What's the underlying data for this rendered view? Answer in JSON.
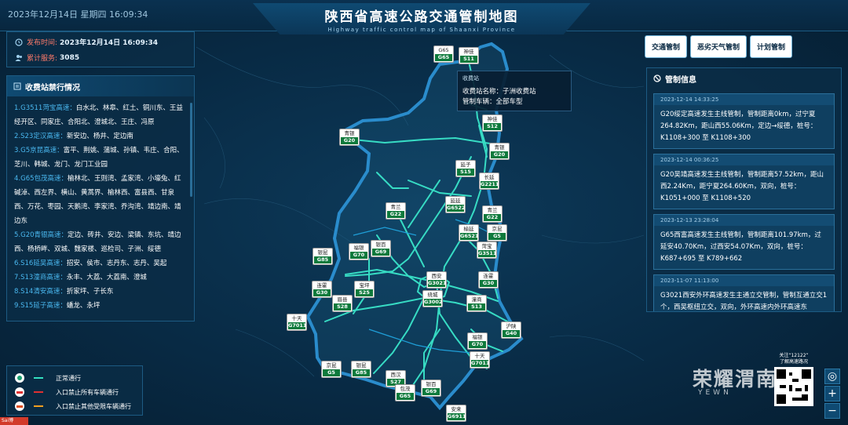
{
  "header": {
    "datetime": "2023年12月14日 星期四  16:09:34",
    "title": "陕西省高速公路交通管制地图",
    "subtitle": "Highway traffic control map of Shaanxi Province"
  },
  "publish": {
    "time_label": "发布时间:",
    "time_value": "2023年12月14日 16:09:34",
    "service_label": "累计服务:",
    "service_value": "3085"
  },
  "toll": {
    "title": "收费站禁行情况",
    "items": [
      {
        "road": "1.G3511菏宝高速：",
        "stations": "白水北、林皋、红土、铜川东、王益经开区、同家庄、合阳北、澄城北、王庄、冯原"
      },
      {
        "road": "2.S23定汉高速：",
        "stations": "新安边、杨井、定边南"
      },
      {
        "road": "3.G5京昆高速：",
        "stations": "富平、荆姚、蒲城、孙镇、韦庄、合阳、芝川、韩城、龙门、龙门工业园"
      },
      {
        "road": "4.G65包茂高速：",
        "stations": "榆林北、王则湾、孟家湾、小壕兔、红碱淖、西左界、横山、黄蒿界、榆林西、富县西、甘泉西、万花、枣园、天鹅湾、李家湾、乔沟湾、靖边南、靖边东"
      },
      {
        "road": "5.G20青银高速：",
        "stations": "定边、砖井、安边、梁镇、东坑、靖边西、杨桥畔、双城、魏家楼、巡检司、子洲、绥德"
      },
      {
        "road": "6.S16延吴高速：",
        "stations": "招安、侯市、志丹东、志丹、吴起"
      },
      {
        "road": "7.S13潼商高速：",
        "stations": "永丰、大荔、大荔南、澄城"
      },
      {
        "road": "8.S14清安高速：",
        "stations": "折家坪、子长东"
      },
      {
        "road": "9.S15延子高速：",
        "stations": "蟠龙、永坪"
      }
    ]
  },
  "legend": {
    "items": [
      {
        "label": "正常通行",
        "color": "#33e0c0"
      },
      {
        "label": "入口禁止所有车辆通行",
        "color": "#e03030"
      },
      {
        "label": "入口禁止其他受限车辆通行",
        "color": "#f0a020"
      }
    ]
  },
  "tabs": [
    "交通管制",
    "恶劣天气管制",
    "计划管制"
  ],
  "info": {
    "title": "管制信息",
    "cards": [
      {
        "time": "2023-12-14 14:33:25",
        "text": "G20绥定高速发生主线管制，管制距离0km，过宁夏264.82Km，距山西55.06Km，定边→绥德，桩号：K1108+300 至 K1108+300"
      },
      {
        "time": "2023-12-14 00:36:25",
        "text": "G20吴靖高速发生主线管制，管制距离57.52km，距山西2.24Km，距宁夏264.60Km，双向，桩号：K1051+000 至 K1108+520"
      },
      {
        "time": "2023-12-13 23:28:04",
        "text": "G65西富高速发生主线管制，管制距离101.97km，过延安40.70Km，过西安54.07Km，双向，桩号：K687+695 至 K789+662"
      },
      {
        "time": "2023-11-07 11:13:00",
        "text": "G3021西安外环高速发生主通立交管制，管制互通立交1个，西吴枢纽立交，双向，外环高速内外环高速东"
      }
    ]
  },
  "tooltip": {
    "title": "收费站",
    "name_row": "收费站名称：子洲收费站",
    "type_row": "管制车辆：全部车型"
  },
  "badges": [
    {
      "name": "G65",
      "code": "G65",
      "top": true
    },
    {
      "name": "神佳",
      "code": "S11"
    },
    {
      "name": "青银",
      "code": "G20"
    },
    {
      "name": "神佳",
      "code": "S12"
    },
    {
      "name": "青银",
      "code": "G20"
    },
    {
      "name": "延子",
      "code": "S15"
    },
    {
      "name": "长延",
      "code": "G2211"
    },
    {
      "name": "青兰",
      "code": "G22"
    },
    {
      "name": "延延",
      "code": "G6522"
    },
    {
      "name": "青兰",
      "code": "G22"
    },
    {
      "name": "榆延",
      "code": "G6521"
    },
    {
      "name": "京昆",
      "code": "G5"
    },
    {
      "name": "菏宝",
      "code": "G3511"
    },
    {
      "name": "福银",
      "code": "G70"
    },
    {
      "name": "银百",
      "code": "G69"
    },
    {
      "name": "银昆",
      "code": "G85"
    },
    {
      "name": "西安",
      "code": "G3021"
    },
    {
      "name": "连霍",
      "code": "G30"
    },
    {
      "name": "宝坪",
      "code": "S25"
    },
    {
      "name": "绕城",
      "code": "G3002"
    },
    {
      "name": "连霍",
      "code": "G30"
    },
    {
      "name": "眉县",
      "code": "S28"
    },
    {
      "name": "潼商",
      "code": "S13"
    },
    {
      "name": "十天",
      "code": "G7011"
    },
    {
      "name": "沪陕",
      "code": "G40"
    },
    {
      "name": "福银",
      "code": "G70"
    },
    {
      "name": "十天",
      "code": "G7011"
    },
    {
      "name": "京昆",
      "code": "G5"
    },
    {
      "name": "银昆",
      "code": "G85"
    },
    {
      "name": "西汉",
      "code": "S27"
    },
    {
      "name": "包茂",
      "code": "G65"
    },
    {
      "name": "银百",
      "code": "G69"
    },
    {
      "name": "安来",
      "code": "G6911"
    }
  ],
  "qr": {
    "caption1": "关注“12122”",
    "caption2": "了解高速路况"
  },
  "watermark": {
    "main": "荣耀渭南",
    "sub": "YEWN"
  },
  "zoom": {
    "locate": "◎",
    "plus": "+",
    "minus": "−"
  },
  "corner": {
    "label": "Sai博"
  }
}
